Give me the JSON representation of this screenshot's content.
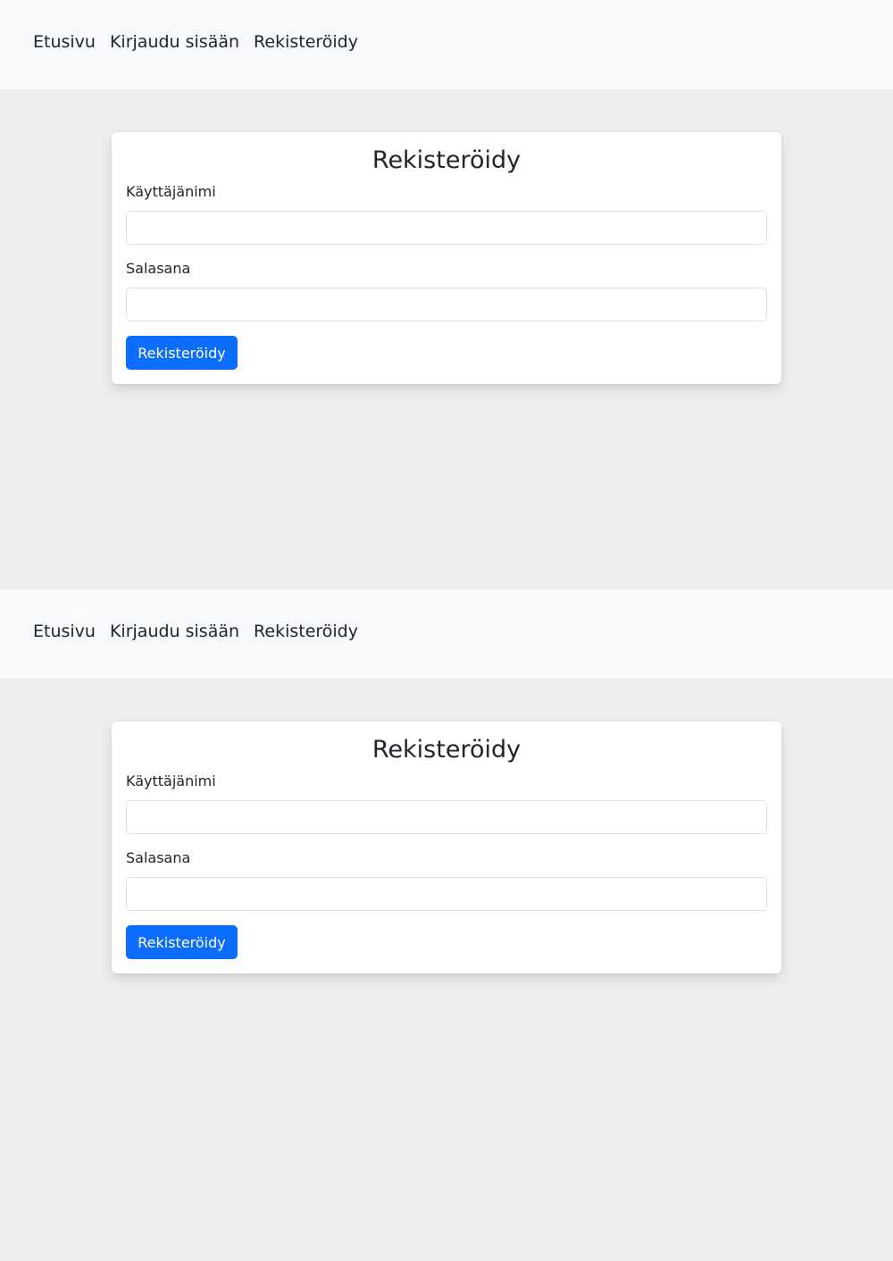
{
  "panels": [
    {
      "nav": {
        "home_label": "Etusivu",
        "login_label": "Kirjaudu sisään",
        "register_label": "Rekisteröidy"
      },
      "form": {
        "title": "Rekisteröidy",
        "username_label": "Käyttäjänimi",
        "username_value": "",
        "password_label": "Salasana",
        "password_value": "",
        "submit_label": "Rekisteröidy"
      }
    },
    {
      "nav": {
        "home_label": "Etusivu",
        "login_label": "Kirjaudu sisään",
        "register_label": "Rekisteröidy"
      },
      "form": {
        "title": "Rekisteröidy",
        "username_label": "Käyttäjänimi",
        "username_value": "",
        "password_label": "Salasana",
        "password_value": "",
        "submit_label": "Rekisteröidy"
      }
    }
  ],
  "colors": {
    "page_background": "#eeeeee",
    "navbar_background": "#f8f9fa",
    "card_background": "#ffffff",
    "primary_button": "#0d6efd",
    "text": "#212529",
    "input_border": "#dee2e6"
  }
}
